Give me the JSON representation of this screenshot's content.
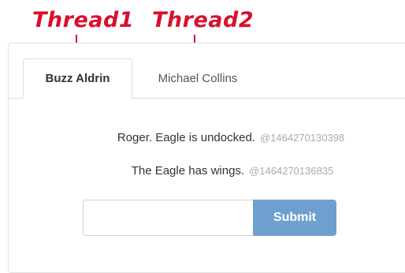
{
  "annotations": {
    "thread1_label": "Thread1",
    "thread2_label": "Thread2",
    "color": "#d8102e"
  },
  "tabs": [
    {
      "label": "Buzz Aldrin",
      "active": true
    },
    {
      "label": "Michael Collins",
      "active": false
    }
  ],
  "messages": [
    {
      "text": "Roger. Eagle is undocked.",
      "timestamp": "@1464270130398"
    },
    {
      "text": "The Eagle has wings.",
      "timestamp": "@1464270136835"
    }
  ],
  "composer": {
    "input_value": "",
    "input_placeholder": "",
    "submit_label": "Submit"
  },
  "colors": {
    "submit_bg": "#6ea0cf",
    "timestamp": "#aaaaaa",
    "text": "#333333"
  }
}
